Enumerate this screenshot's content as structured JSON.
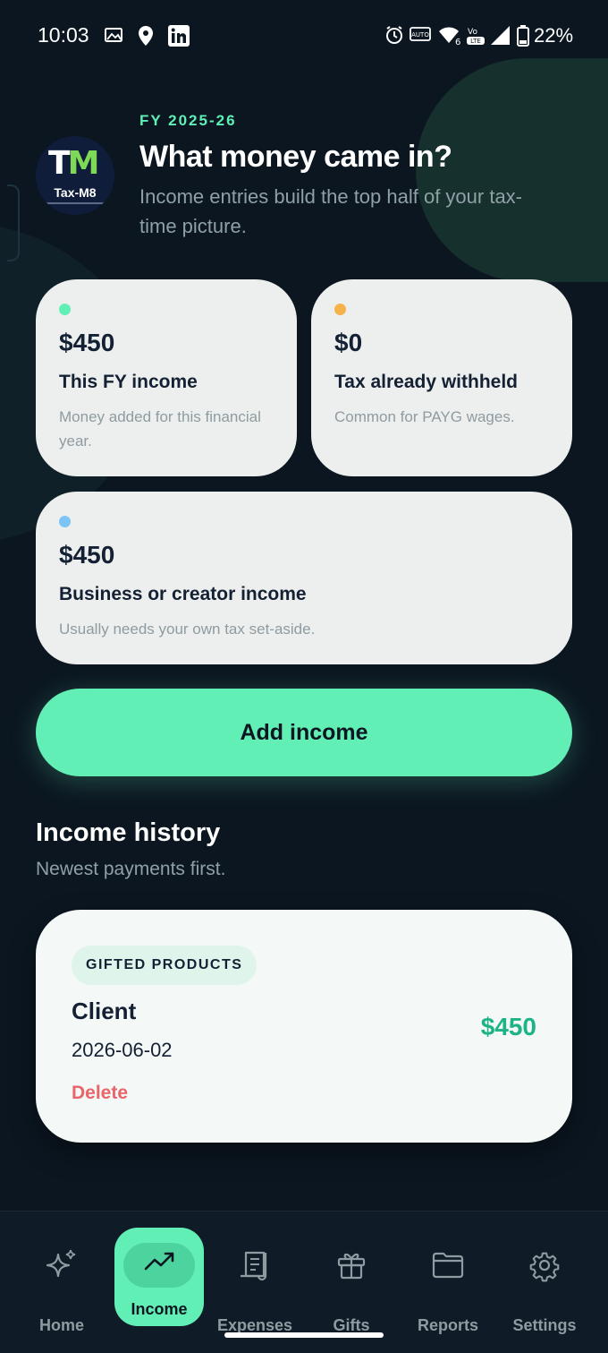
{
  "status_bar": {
    "time": "10:03",
    "battery": "22%",
    "icons": [
      "image-icon",
      "location-icon",
      "linkedin-icon",
      "alarm-icon",
      "auto-hz-icon",
      "wifi-6-icon",
      "volte-icon",
      "cellular-signal-icon",
      "battery-icon"
    ]
  },
  "header": {
    "logo_text": "Tax-M8",
    "logo_letters": "TM",
    "fy_label": "FY 2025-26",
    "title": "What money came in?",
    "subtitle": "Income entries build the top half of your tax-time picture."
  },
  "summary_cards": [
    {
      "amount": "$450",
      "label": "This FY income",
      "description": "Money added for this financial year.",
      "dot_color": "#62efb6"
    },
    {
      "amount": "$0",
      "label": "Tax already withheld",
      "description": "Common for PAYG wages.",
      "dot_color": "#f5b24a"
    },
    {
      "amount": "$450",
      "label": "Business or creator income",
      "description": "Usually needs your own tax set-aside.",
      "dot_color": "#7cc4f5"
    }
  ],
  "add_button": {
    "label": "Add income"
  },
  "history": {
    "title": "Income history",
    "subtitle": "Newest payments first.",
    "entries": [
      {
        "category": "GIFTED PRODUCTS",
        "source": "Client",
        "date": "2026-06-02",
        "amount": "$450",
        "delete_label": "Delete"
      }
    ]
  },
  "nav": {
    "active": "Income",
    "items": [
      {
        "label": "Home",
        "icon": "sparkle-icon"
      },
      {
        "label": "Income",
        "icon": "trending-up-icon"
      },
      {
        "label": "Expenses",
        "icon": "receipt-icon"
      },
      {
        "label": "Gifts",
        "icon": "gift-icon"
      },
      {
        "label": "Reports",
        "icon": "folder-icon"
      },
      {
        "label": "Settings",
        "icon": "gear-icon"
      }
    ]
  },
  "colors": {
    "background": "#0b1620",
    "accent": "#62efb6",
    "card": "#ecefed",
    "income_amount": "#1eb386",
    "delete": "#e8656b"
  }
}
